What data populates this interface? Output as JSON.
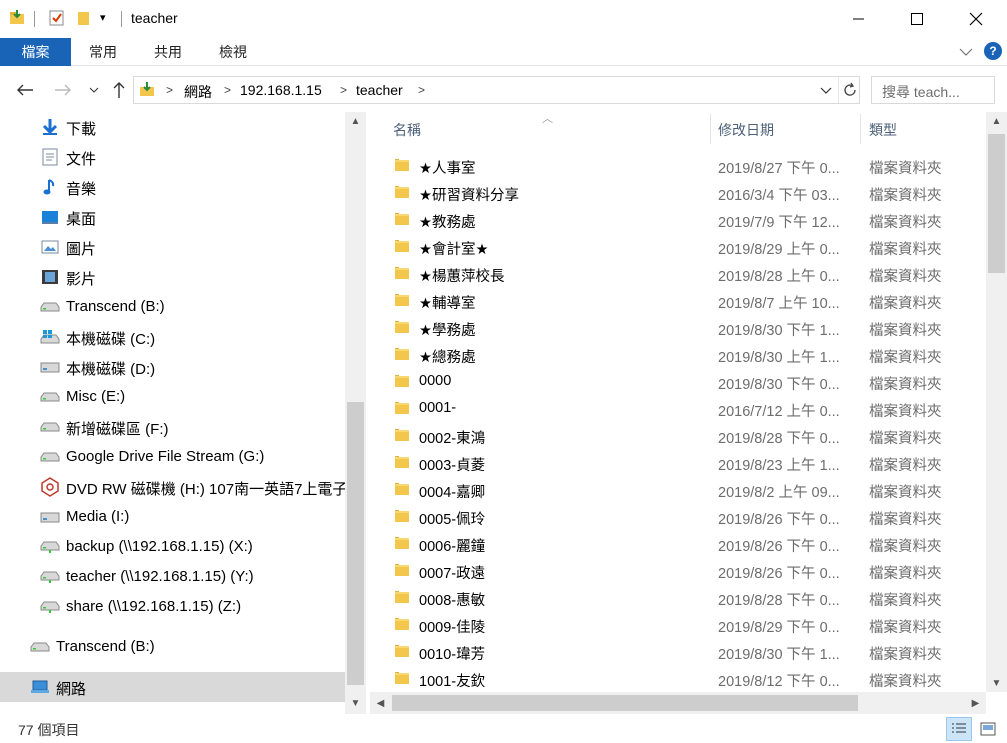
{
  "window": {
    "title": "teacher",
    "qat_dropdown": "▾",
    "controls": {
      "minimize": "—",
      "maximize": "☐",
      "close": "✕"
    }
  },
  "ribbon": {
    "tabs": [
      {
        "label": "檔案"
      },
      {
        "label": "常用"
      },
      {
        "label": "共用"
      },
      {
        "label": "檢視"
      }
    ],
    "help": "?"
  },
  "addressbar": {
    "breadcrumbs": [
      "網路",
      "192.168.1.15",
      "teacher"
    ],
    "search_placeholder": "搜尋 teach..."
  },
  "navpane": {
    "items": [
      {
        "label": "下載",
        "icon": "download-icon"
      },
      {
        "label": "文件",
        "icon": "document-icon"
      },
      {
        "label": "音樂",
        "icon": "music-icon"
      },
      {
        "label": "桌面",
        "icon": "desktop-icon"
      },
      {
        "label": "圖片",
        "icon": "pictures-icon"
      },
      {
        "label": "影片",
        "icon": "videos-icon"
      },
      {
        "label": "Transcend (B:)",
        "icon": "drive-icon"
      },
      {
        "label": "本機磁碟 (C:)",
        "icon": "windows-drive-icon"
      },
      {
        "label": "本機磁碟 (D:)",
        "icon": "drive-icon"
      },
      {
        "label": "Misc (E:)",
        "icon": "drive-icon"
      },
      {
        "label": "新增磁碟區 (F:)",
        "icon": "drive-icon"
      },
      {
        "label": "Google Drive File Stream (G:)",
        "icon": "drive-icon"
      },
      {
        "label": "DVD RW 磁碟機 (H:) 107南一英語7上電子",
        "icon": "dvd-icon"
      },
      {
        "label": "Media (I:)",
        "icon": "drive-icon"
      },
      {
        "label": "backup (\\\\192.168.1.15) (X:)",
        "icon": "network-drive-icon"
      },
      {
        "label": "teacher (\\\\192.168.1.15) (Y:)",
        "icon": "network-drive-icon"
      },
      {
        "label": "share (\\\\192.168.1.15) (Z:)",
        "icon": "network-drive-icon"
      }
    ],
    "root_items": [
      {
        "label": "Transcend (B:)",
        "icon": "drive-icon"
      },
      {
        "label": "網路",
        "icon": "network-icon",
        "selected": true
      }
    ]
  },
  "content": {
    "columns": {
      "name": "名稱",
      "date": "修改日期",
      "type": "類型"
    },
    "rows": [
      {
        "name": "★人事室",
        "date": "2019/8/27 下午 0...",
        "type": "檔案資料夾"
      },
      {
        "name": "★研習資料分享",
        "date": "2016/3/4 下午 03...",
        "type": "檔案資料夾"
      },
      {
        "name": "★教務處",
        "date": "2019/7/9 下午 12...",
        "type": "檔案資料夾"
      },
      {
        "name": "★會計室★",
        "date": "2019/8/29 上午 0...",
        "type": "檔案資料夾"
      },
      {
        "name": "★楊蕙萍校長",
        "date": "2019/8/28 上午 0...",
        "type": "檔案資料夾"
      },
      {
        "name": "★輔導室",
        "date": "2019/8/7 上午 10...",
        "type": "檔案資料夾"
      },
      {
        "name": "★學務處",
        "date": "2019/8/30 下午 1...",
        "type": "檔案資料夾"
      },
      {
        "name": "★總務處",
        "date": "2019/8/30 上午 1...",
        "type": "檔案資料夾"
      },
      {
        "name": "0000",
        "date": "2019/8/30 下午 0...",
        "type": "檔案資料夾"
      },
      {
        "name": "0001-",
        "date": "2016/7/12 上午 0...",
        "type": "檔案資料夾"
      },
      {
        "name": "0002-東鴻",
        "date": "2019/8/28 下午 0...",
        "type": "檔案資料夾"
      },
      {
        "name": "0003-貞菱",
        "date": "2019/8/23 上午 1...",
        "type": "檔案資料夾"
      },
      {
        "name": "0004-嘉卿",
        "date": "2019/8/2 上午 09...",
        "type": "檔案資料夾"
      },
      {
        "name": "0005-佩玲",
        "date": "2019/8/26 下午 0...",
        "type": "檔案資料夾"
      },
      {
        "name": "0006-麗鐘",
        "date": "2019/8/26 下午 0...",
        "type": "檔案資料夾"
      },
      {
        "name": "0007-政遠",
        "date": "2019/8/26 下午 0...",
        "type": "檔案資料夾"
      },
      {
        "name": "0008-惠敏",
        "date": "2019/8/28 下午 0...",
        "type": "檔案資料夾"
      },
      {
        "name": "0009-佳陵",
        "date": "2019/8/29 下午 0...",
        "type": "檔案資料夾"
      },
      {
        "name": "0010-瑋芳",
        "date": "2019/8/30 下午 1...",
        "type": "檔案資料夾"
      },
      {
        "name": "1001-友欽",
        "date": "2019/8/12 下午 0...",
        "type": "檔案資料夾"
      }
    ]
  },
  "statusbar": {
    "item_count": "77 個項目"
  },
  "colors": {
    "accent": "#1a64b8",
    "folder": "#f3c74c",
    "selected": "#d9d9d9"
  }
}
